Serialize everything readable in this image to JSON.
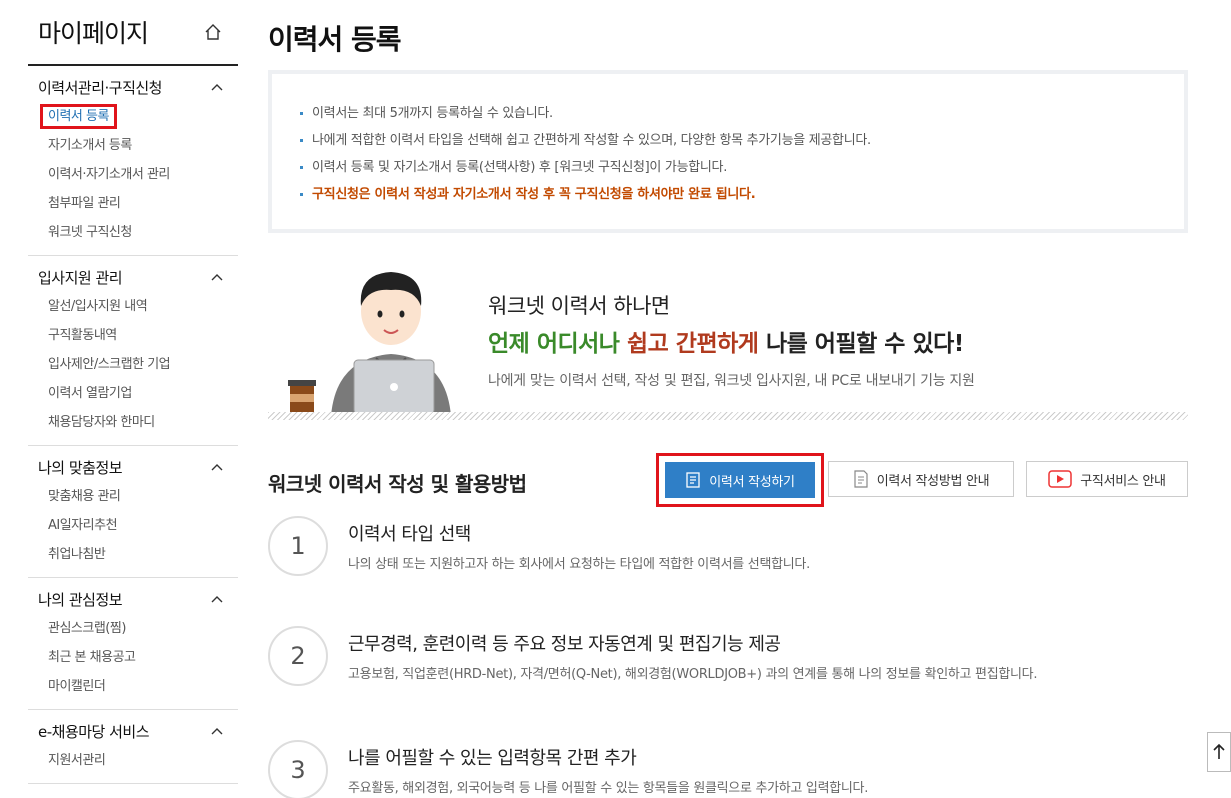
{
  "sidebar": {
    "title": "마이페이지",
    "groups": [
      {
        "title": "이력서관리·구직신청",
        "items": [
          "이력서 등록",
          "자기소개서 등록",
          "이력서·자기소개서 관리",
          "첨부파일 관리",
          "워크넷 구직신청"
        ]
      },
      {
        "title": "입사지원 관리",
        "items": [
          "알선/입사지원 내역",
          "구직활동내역",
          "입사제안/스크랩한 기업",
          "이력서 열람기업",
          "채용담당자와 한마디"
        ]
      },
      {
        "title": "나의 맞춤정보",
        "items": [
          "맞춤채용 관리",
          "AI일자리추천",
          "취업나침반"
        ]
      },
      {
        "title": "나의 관심정보",
        "items": [
          "관심스크랩(찜)",
          "최근 본 채용공고",
          "마이캘린더"
        ]
      },
      {
        "title": "e-채용마당 서비스",
        "items": [
          "지원서관리"
        ]
      }
    ]
  },
  "main": {
    "title": "이력서 등록",
    "notices": [
      "이력서는 최대 5개까지 등록하실 수 있습니다.",
      "나에게 적합한 이력서 타입을 선택해 쉽고 간편하게 작성할 수 있으며, 다양한 항목 추가기능을 제공합니다.",
      "이력서 등록 및 자기소개서 등록(선택사항) 후 [워크넷 구직신청]이 가능합니다.",
      "구직신청은 이력서 작성과 자기소개서 작성 후 꼭 구직신청을 하셔야만 완료 됩니다."
    ],
    "promo": {
      "line1": "워크넷 이력서 하나면",
      "line2_green": "언제 어디서나",
      "line2_space": " ",
      "line2_red": "쉽고 간편하게",
      "line2_rest": " 나를 어필할 수 있다!",
      "desc": "나에게 맞는 이력서 선택, 작성 및 편집, 워크넷 입사지원, 내 PC로 내보내기 기능 지원"
    },
    "howto_title": "워크넷 이력서 작성 및 활용방법",
    "buttons": {
      "write": "이력서 작성하기",
      "guide": "이력서 작성방법 안내",
      "service": "구직서비스 안내"
    },
    "steps": [
      {
        "num": "1",
        "title": "이력서 타입 선택",
        "desc": "나의 상태 또는 지원하고자 하는 회사에서 요청하는 타입에 적합한 이력서를 선택합니다."
      },
      {
        "num": "2",
        "title": "근무경력, 훈련이력 등 주요 정보 자동연계 및 편집기능 제공",
        "desc": "고용보험, 직업훈련(HRD-Net), 자격/면허(Q-Net), 해외경험(WORLDJOB+) 과의 연계를 통해 나의 정보를 확인하고 편집합니다."
      },
      {
        "num": "3",
        "title": "나를 어필할 수 있는 입력항목 간편 추가",
        "desc": "주요활동, 해외경험, 외국어능력 등 나를 어필할 수 있는 항목들을 원클릭으로 추가하고 입력합니다."
      }
    ]
  }
}
